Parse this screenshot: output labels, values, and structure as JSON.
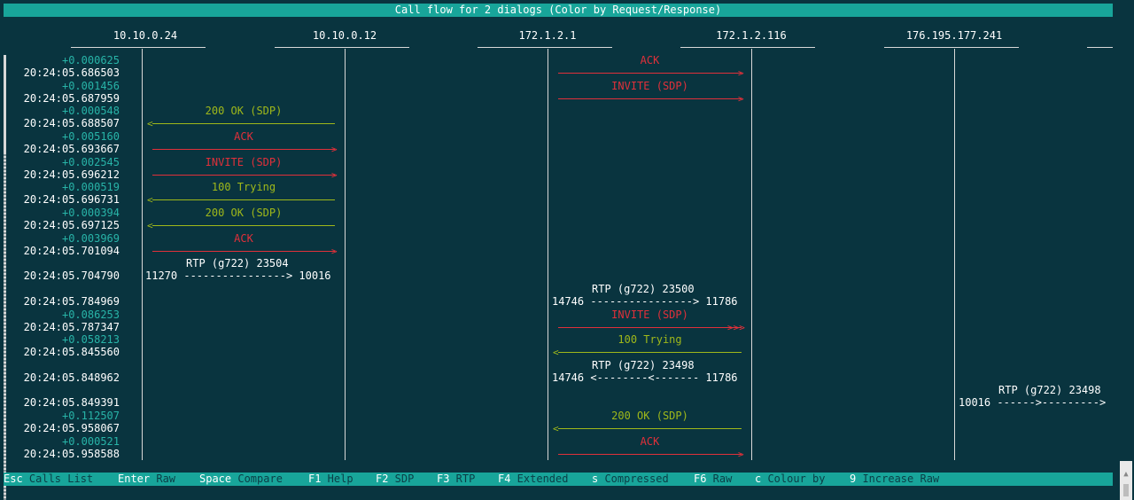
{
  "window": {
    "title": "Call flow for 2 dialogs (Color by Request/Response)"
  },
  "colors": {
    "request": "#e0303a",
    "response": "#9fb81a",
    "delta": "#28b4a8",
    "background": "#09343f",
    "bar": "#18a59a"
  },
  "hosts": [
    "10.10.0.24",
    "10.10.0.12",
    "172.1.2.1",
    "172.1.2.116",
    "176.195.177.241"
  ],
  "rows": [
    {
      "delta": "+0.000625",
      "time": "20:24:05.686503"
    },
    {
      "delta": "+0.001456",
      "time": "20:24:05.687959"
    },
    {
      "delta": "+0.000548",
      "time": "20:24:05.688507"
    },
    {
      "delta": "+0.005160",
      "time": "20:24:05.693667"
    },
    {
      "delta": "+0.002545",
      "time": "20:24:05.696212"
    },
    {
      "delta": "+0.000519",
      "time": "20:24:05.696731"
    },
    {
      "delta": "+0.000394",
      "time": "20:24:05.697125"
    },
    {
      "delta": "+0.003969",
      "time": "20:24:05.701094"
    },
    {
      "delta": "",
      "time": "20:24:05.704790"
    },
    {
      "delta": "",
      "time": "20:24:05.784969"
    },
    {
      "delta": "+0.086253",
      "time": "20:24:05.787347"
    },
    {
      "delta": "+0.058213",
      "time": "20:24:05.845560"
    },
    {
      "delta": "",
      "time": "20:24:05.848962"
    },
    {
      "delta": "",
      "time": "20:24:05.849391"
    },
    {
      "delta": "+0.112507",
      "time": "20:24:05.958067"
    },
    {
      "delta": "+0.000521",
      "time": "20:24:05.958588"
    }
  ],
  "messages": [
    {
      "row": 0,
      "label": "ACK",
      "type": "req",
      "from": 2,
      "to": 3,
      "head": ">"
    },
    {
      "row": 1,
      "label": "INVITE (SDP)",
      "type": "req",
      "from": 2,
      "to": 3,
      "head": ">"
    },
    {
      "row": 2,
      "label": "200 OK (SDP)",
      "type": "resp",
      "from": 1,
      "to": 0,
      "head": "<"
    },
    {
      "row": 3,
      "label": "ACK",
      "type": "req",
      "from": 0,
      "to": 1,
      "head": ">"
    },
    {
      "row": 4,
      "label": "INVITE (SDP)",
      "type": "req",
      "from": 0,
      "to": 1,
      "head": ">"
    },
    {
      "row": 5,
      "label": "100 Trying",
      "type": "resp",
      "from": 1,
      "to": 0,
      "head": "<"
    },
    {
      "row": 6,
      "label": "200 OK (SDP)",
      "type": "resp",
      "from": 1,
      "to": 0,
      "head": "<"
    },
    {
      "row": 7,
      "label": "ACK",
      "type": "req",
      "from": 0,
      "to": 1,
      "head": ">"
    },
    {
      "row": 10,
      "label": "INVITE (SDP)",
      "type": "req",
      "from": 2,
      "to": 3,
      "head": ">>>"
    },
    {
      "row": 11,
      "label": "100 Trying",
      "type": "resp",
      "from": 3,
      "to": 2,
      "head": "<"
    },
    {
      "row": 14,
      "label": "200 OK (SDP)",
      "type": "resp",
      "from": 3,
      "to": 2,
      "head": "<"
    },
    {
      "row": 15,
      "label": "ACK",
      "type": "req",
      "from": 2,
      "to": 3,
      "head": ">"
    }
  ],
  "rtp": [
    {
      "row": 8,
      "title": "RTP (g722) 23504",
      "line": "11270 ----------------> 10016",
      "col": "a"
    },
    {
      "row": 9,
      "title": "RTP (g722) 23500",
      "line": "14746 ----------------> 11786",
      "col": "b"
    },
    {
      "row": 12,
      "title": "RTP (g722) 23498",
      "line": "14746 <--------<------- 11786",
      "col": "b"
    },
    {
      "row": 13,
      "title": "RTP (g722) 23498",
      "line": "10016 ------>---------> ",
      "col": "c"
    }
  ],
  "footer": [
    {
      "key": "Esc",
      "desc": "Calls List"
    },
    {
      "key": "Enter",
      "desc": "Raw"
    },
    {
      "key": "Space",
      "desc": "Compare"
    },
    {
      "key": "F1",
      "desc": "Help"
    },
    {
      "key": "F2",
      "desc": "SDP"
    },
    {
      "key": "F3",
      "desc": "RTP"
    },
    {
      "key": "F4",
      "desc": "Extended"
    },
    {
      "key": "s",
      "desc": "Compressed"
    },
    {
      "key": "F6",
      "desc": "Raw"
    },
    {
      "key": "c",
      "desc": "Colour by"
    },
    {
      "key": "9",
      "desc": "Increase Raw"
    }
  ]
}
